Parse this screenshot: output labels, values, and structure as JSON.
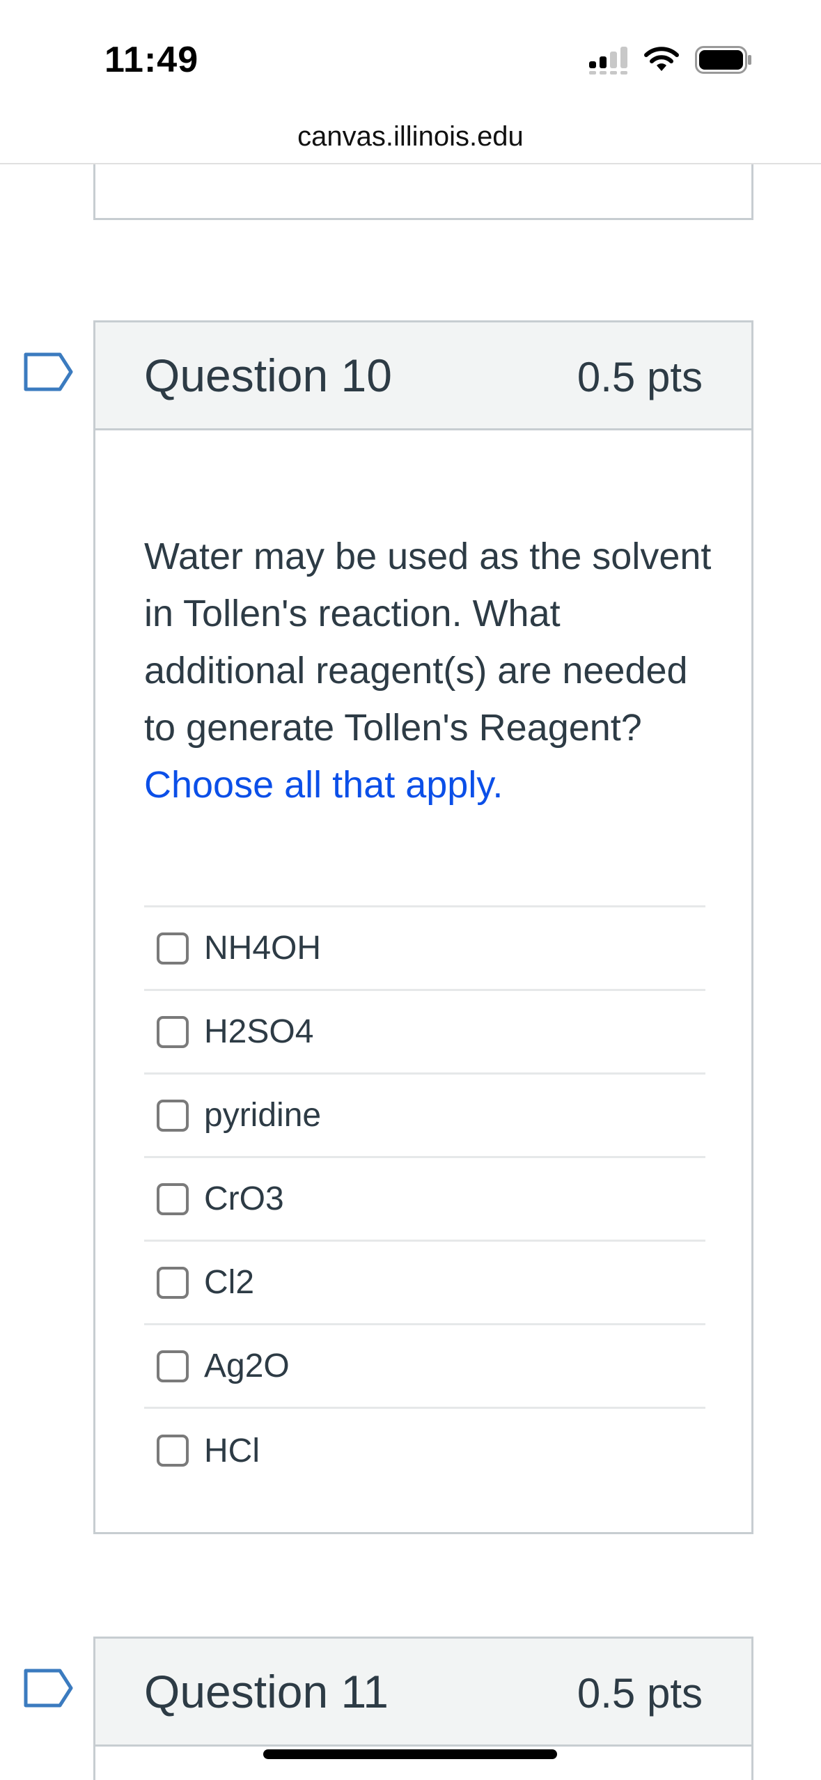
{
  "status_bar": {
    "time": "11:49"
  },
  "browser": {
    "url": "canvas.illinois.edu"
  },
  "questions": [
    {
      "title": "Question 10",
      "points": "0.5 pts",
      "text": "Water may be used as the solvent in Tollen's reaction. What additional reagent(s) are needed to generate Tollen's Reagent?",
      "emphasis": "Choose all that apply.",
      "answers": [
        "NH4OH",
        "H2SO4",
        "pyridine",
        "CrO3",
        "Cl2",
        "Ag2O",
        "HCl"
      ]
    },
    {
      "title": "Question 11",
      "points": "0.5 pts"
    }
  ],
  "colors": {
    "accent_blue": "#0b4fe8",
    "flag_blue": "#3b7bbf",
    "header_bg": "#f2f4f4",
    "border": "#c7cdd1"
  }
}
